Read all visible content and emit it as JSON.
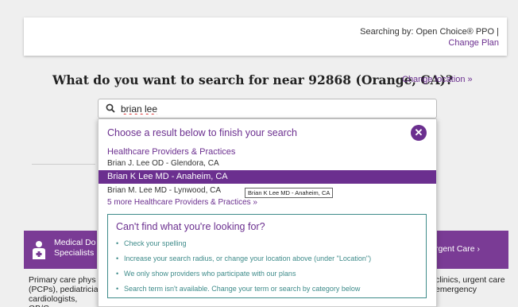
{
  "plan_bar": {
    "searching_by": "Searching by: Open Choice® PPO |",
    "change_plan": "Change Plan"
  },
  "headline": "What do you want to search for near 92868 (Orange, CA)?",
  "change_location": "Change location  »",
  "search": {
    "value": "brian lee",
    "icon": "search-icon"
  },
  "cards": {
    "left_label": "Medical Do Specialists",
    "left_desc": "Primary care phys (PCPs), pediatricia cardiologists, OB/G",
    "right_label": "rgent Care  ›",
    "right_desc": "clinics, urgent care emergency"
  },
  "dropdown": {
    "heading": "Choose a result below to finish your search",
    "close_icon": "close-icon",
    "category": "Healthcare Providers & Practices",
    "items": [
      "Brian J. Lee OD - Glendora, CA",
      "Brian K Lee MD - Anaheim, CA",
      "Brian M. Lee MD - Lynwood, CA"
    ],
    "more": "5 more Healthcare Providers & Practices  »",
    "tooltip": "Brian K Lee MD - Anaheim, CA",
    "help": {
      "title": "Can't find what you're looking for?",
      "tips": [
        "Check your spelling",
        "Increase your search radius, or change your location above (under \"Location\")",
        "We only show providers who participate with our plans",
        "Search term isn't available. Change your term or search by category below"
      ]
    }
  },
  "colors": {
    "accent": "#6b2f8f",
    "teal": "#3e8b8a"
  }
}
